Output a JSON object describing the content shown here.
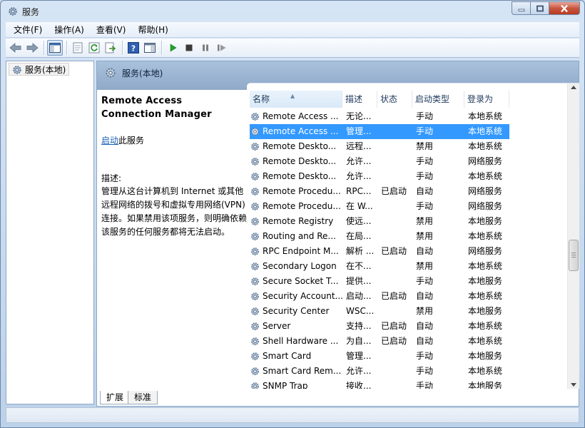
{
  "window": {
    "title": "服务"
  },
  "menu": [
    {
      "label": "文件(F)",
      "name": "menu-file"
    },
    {
      "label": "操作(A)",
      "name": "menu-action"
    },
    {
      "label": "查看(V)",
      "name": "menu-view"
    },
    {
      "label": "帮助(H)",
      "name": "menu-help"
    }
  ],
  "toolbar": {
    "buttons": [
      "back-icon",
      "forward-icon",
      "show-hide-console-tree-icon",
      "properties-icon",
      "refresh-icon",
      "export-list-icon",
      "help-icon",
      "show-action-pane-icon",
      "start-service-icon",
      "stop-service-icon",
      "pause-service-icon",
      "resume-service-icon"
    ]
  },
  "tree": {
    "root_label": "服务(本地)"
  },
  "panel": {
    "header": "服务(本地)"
  },
  "details": {
    "service_name": "Remote Access Connection Manager",
    "start_link": "启动",
    "start_suffix": "此服务",
    "desc_label": "描述:",
    "description": "管理从这台计算机到 Internet 或其他远程网络的拨号和虚拟专用网络(VPN)连接。如果禁用该项服务，则明确依赖该服务的任何服务都将无法启动。"
  },
  "columns": [
    "名称",
    "描述",
    "状态",
    "启动类型",
    "登录为"
  ],
  "services": [
    {
      "name": "Remote Access ...",
      "desc": "无论...",
      "status": "",
      "startup": "手动",
      "logon": "本地系统"
    },
    {
      "name": "Remote Access ...",
      "desc": "管理...",
      "status": "",
      "startup": "手动",
      "logon": "本地系统"
    },
    {
      "name": "Remote Deskto...",
      "desc": "远程...",
      "status": "",
      "startup": "禁用",
      "logon": "本地系统"
    },
    {
      "name": "Remote Deskto...",
      "desc": "允许...",
      "status": "",
      "startup": "手动",
      "logon": "网络服务"
    },
    {
      "name": "Remote Deskto...",
      "desc": "允许...",
      "status": "",
      "startup": "手动",
      "logon": "本地系统"
    },
    {
      "name": "Remote Procedu...",
      "desc": "RPC...",
      "status": "已启动",
      "startup": "自动",
      "logon": "网络服务"
    },
    {
      "name": "Remote Procedu...",
      "desc": "在 W...",
      "status": "",
      "startup": "手动",
      "logon": "网络服务"
    },
    {
      "name": "Remote Registry",
      "desc": "使远...",
      "status": "",
      "startup": "禁用",
      "logon": "本地服务"
    },
    {
      "name": "Routing and Re...",
      "desc": "在局...",
      "status": "",
      "startup": "禁用",
      "logon": "本地系统"
    },
    {
      "name": "RPC Endpoint M...",
      "desc": "解析 ...",
      "status": "已启动",
      "startup": "自动",
      "logon": "网络服务"
    },
    {
      "name": "Secondary Logon",
      "desc": "在不...",
      "status": "",
      "startup": "禁用",
      "logon": "本地系统"
    },
    {
      "name": "Secure Socket T...",
      "desc": "提供...",
      "status": "",
      "startup": "手动",
      "logon": "本地服务"
    },
    {
      "name": "Security Account...",
      "desc": "启动...",
      "status": "已启动",
      "startup": "自动",
      "logon": "本地系统"
    },
    {
      "name": "Security Center",
      "desc": "WSC...",
      "status": "",
      "startup": "禁用",
      "logon": "本地服务"
    },
    {
      "name": "Server",
      "desc": "支持...",
      "status": "已启动",
      "startup": "自动",
      "logon": "本地系统"
    },
    {
      "name": "Shell Hardware ...",
      "desc": "为自...",
      "status": "已启动",
      "startup": "自动",
      "logon": "本地系统"
    },
    {
      "name": "Smart Card",
      "desc": "管理...",
      "status": "",
      "startup": "手动",
      "logon": "本地服务"
    },
    {
      "name": "Smart Card Rem...",
      "desc": "允许...",
      "status": "",
      "startup": "手动",
      "logon": "本地系统"
    },
    {
      "name": "SNMP Trap",
      "desc": "接收...",
      "status": "",
      "startup": "手动",
      "logon": "本地服务"
    }
  ],
  "selected_row": 1,
  "tabs": [
    "扩展",
    "标准"
  ],
  "colors": {
    "selection": "#3399ff",
    "link": "#1a5fb4",
    "header_band": "#9bb4d2"
  }
}
